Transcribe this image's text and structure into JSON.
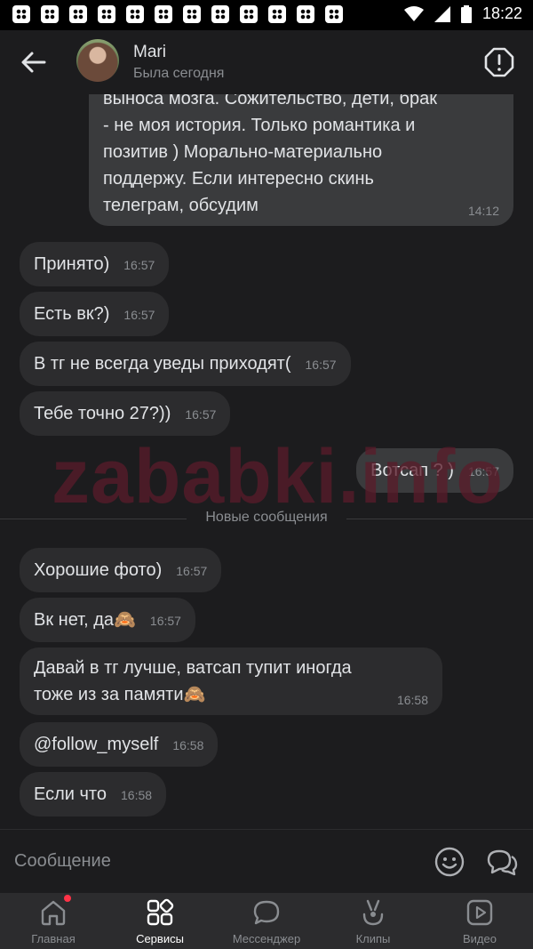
{
  "status_bar": {
    "time": "18:22"
  },
  "header": {
    "contact_name": "Mari",
    "contact_status": "Была сегодня"
  },
  "messages": [
    {
      "direction": "outgoing",
      "text": "выноса мозга. Сожительство, дети, брак - не моя история. Только романтика и позитив ) Морально-материально поддержу. Если интересно скинь телеграм, обсудим",
      "time": "14:12"
    },
    {
      "direction": "incoming",
      "text": "Принято)",
      "time": "16:57"
    },
    {
      "direction": "incoming",
      "text": "Есть вк?)",
      "time": "16:57"
    },
    {
      "direction": "incoming",
      "text": "В тг не всегда уведы приходят(",
      "time": "16:57"
    },
    {
      "direction": "incoming",
      "text": "Тебе точно 27?))",
      "time": "16:57"
    },
    {
      "direction": "outgoing",
      "text": "Вотсап ? )",
      "time": "16:57"
    },
    {
      "direction": "incoming",
      "text": "Хорошие фото)",
      "time": "16:57"
    },
    {
      "direction": "incoming",
      "text": "Вк нет, да🙈",
      "time": "16:57"
    },
    {
      "direction": "incoming",
      "text": "Давай в тг лучше, ватсап тупит иногда тоже из за памяти🙈",
      "time": "16:58"
    },
    {
      "direction": "incoming",
      "text": "@follow_myself",
      "time": "16:58"
    },
    {
      "direction": "incoming",
      "text": "Если что",
      "time": "16:58"
    }
  ],
  "out_lines": [
    "выноса мозга. Сожительство, дети, брак",
    "- не моя история. Только романтика и",
    "позитив ) Морально-материально",
    "поддержу. Если интересно скинь",
    "телеграм, обсудим"
  ],
  "long_lines": [
    "Давай в тг лучше, ватсап тупит иногда",
    "тоже из за памяти🙈"
  ],
  "divider_label": "Новые сообщения",
  "watermark": "zababki.info",
  "composer": {
    "placeholder": "Сообщение"
  },
  "nav": [
    {
      "label": "Главная",
      "icon": "home-icon",
      "active": false,
      "badge": true
    },
    {
      "label": "Сервисы",
      "icon": "services-icon",
      "active": true,
      "badge": false
    },
    {
      "label": "Мессенджер",
      "icon": "messenger-icon",
      "active": false,
      "badge": false
    },
    {
      "label": "Клипы",
      "icon": "clips-icon",
      "active": false,
      "badge": false
    },
    {
      "label": "Видео",
      "icon": "video-icon",
      "active": false,
      "badge": false
    }
  ],
  "colors": {
    "background": "#1c1c1e",
    "bubble_in": "#2c2c2e",
    "bubble_out": "#3a3b3d",
    "badge": "#ff3347",
    "watermark": "#5a1b2a"
  }
}
